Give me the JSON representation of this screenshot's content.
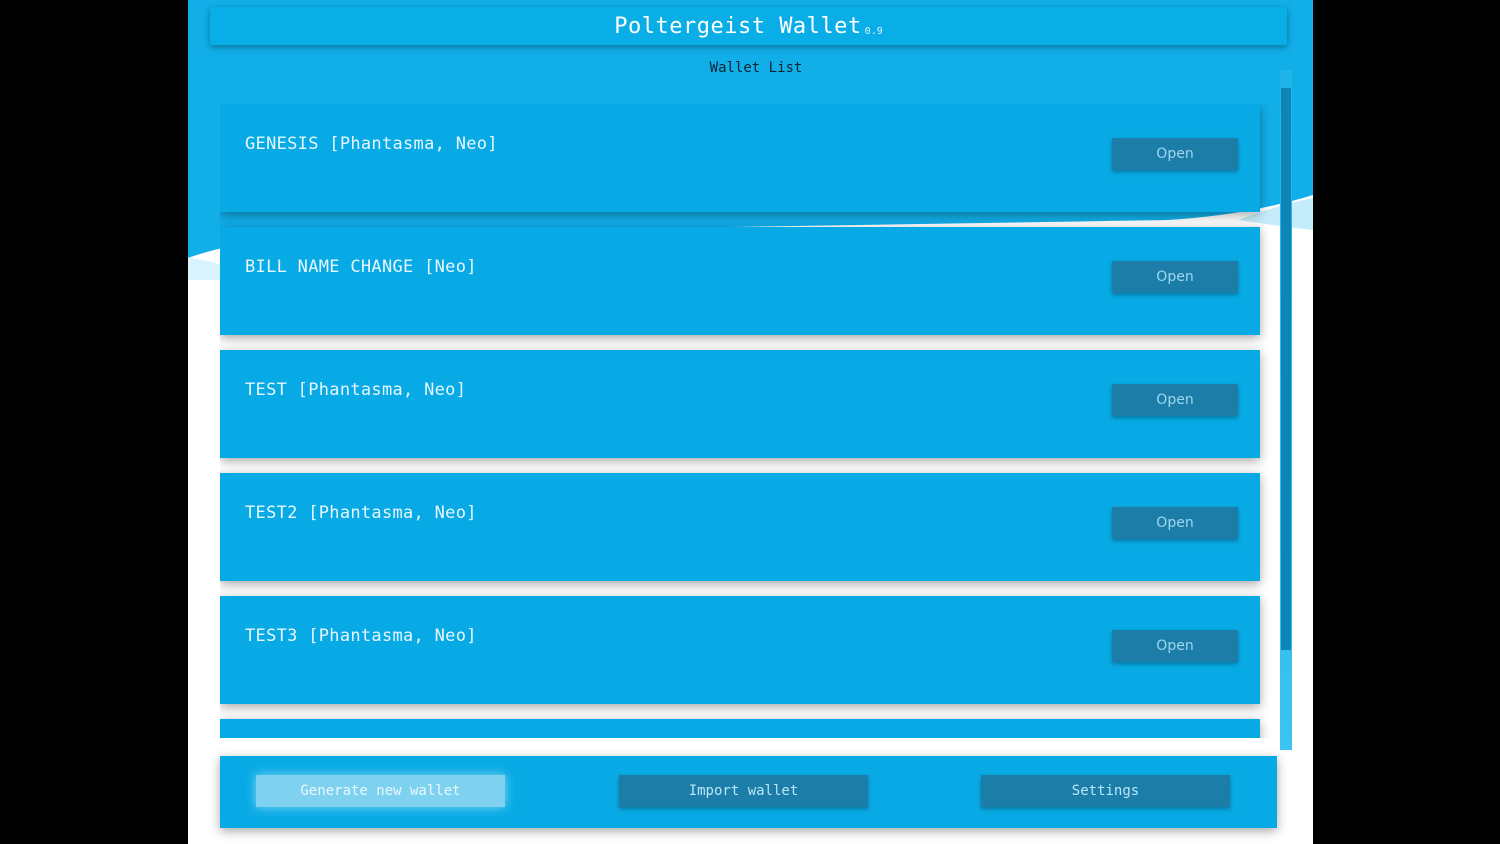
{
  "app": {
    "title": "Poltergeist Wallet",
    "version": "0.9",
    "subtitle": "Wallet List"
  },
  "wallets": [
    {
      "name": "GENESIS [Phantasma, Neo]",
      "action": "Open"
    },
    {
      "name": "BILL NAME CHANGE [Neo]",
      "action": "Open"
    },
    {
      "name": "TEST [Phantasma, Neo]",
      "action": "Open"
    },
    {
      "name": "TEST2 [Phantasma, Neo]",
      "action": "Open"
    },
    {
      "name": "TEST3 [Phantasma, Neo]",
      "action": "Open"
    },
    {
      "name": "",
      "action": ""
    }
  ],
  "footer": {
    "generate_label": "Generate new wallet",
    "import_label": "Import wallet",
    "settings_label": "Settings"
  },
  "colors": {
    "accent": "#08aae5",
    "button": "#1c7ea8",
    "button_highlight": "#7fd2ef"
  }
}
